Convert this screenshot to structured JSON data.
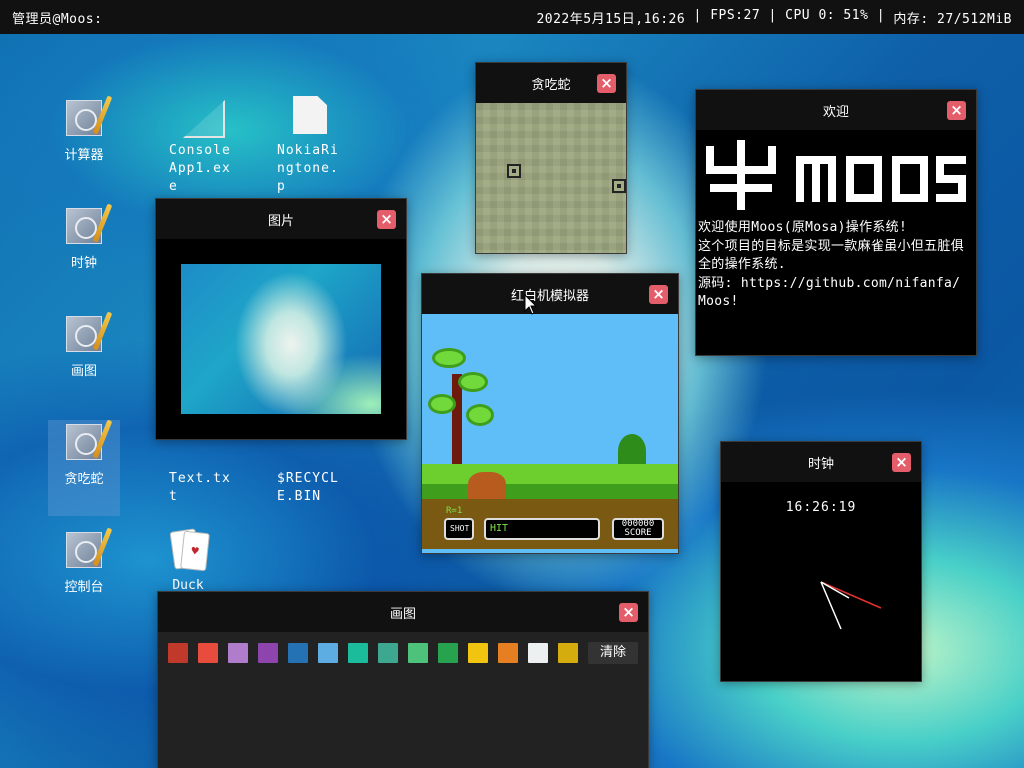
{
  "topbar": {
    "user": "管理员@Moos:",
    "datetime": "2022年5月15日,16:26",
    "sep": " | ",
    "fps": "FPS:27",
    "cpu": "CPU 0: 51%",
    "memory": "内存: 27/512MiB"
  },
  "desktop": {
    "icons": [
      {
        "label": "计算器"
      },
      {
        "label": "时钟"
      },
      {
        "label": "画图"
      },
      {
        "label": "贪吃蛇"
      },
      {
        "label": "控制台"
      }
    ],
    "files": [
      {
        "label": "ConsoleApp1.exe"
      },
      {
        "label": "NokiaRingtone.p"
      },
      {
        "label": "Text.txt"
      },
      {
        "label": "$RECYCLE.BIN"
      },
      {
        "label": "Duck"
      }
    ]
  },
  "windows": {
    "snake": {
      "title": "贪吃蛇",
      "close": "×"
    },
    "picture": {
      "title": "图片",
      "close": "×"
    },
    "nes": {
      "title": "红白机模拟器",
      "close": "×",
      "hud_round": "R=1",
      "hud_shot": "SHOT",
      "hud_hit": "HIT",
      "hud_score_value": "000000",
      "hud_score": "SCORE"
    },
    "welcome": {
      "title": "欢迎",
      "close": "×",
      "lines": [
        "欢迎使用Moos(原Mosa)操作系统!",
        "这个项目的目标是实现一款麻雀虽小但五脏俱",
        "全的操作系统.",
        "源码: https://github.com/nifanfa/",
        "Moos!"
      ]
    },
    "clock": {
      "title": "时钟",
      "close": "×",
      "time": "16:26:19"
    },
    "paint": {
      "title": "画图",
      "close": "×",
      "clear_label": "清除",
      "swatches": [
        "#c0392b",
        "#e74c3c",
        "#b07ccc",
        "#8e44ad",
        "#2472b3",
        "#5dade2",
        "#1abc9c",
        "#3da88f",
        "#4ec17a",
        "#27a24f",
        "#f1c40f",
        "#e67e22",
        "#ecf0f1",
        "#d4ac0d"
      ]
    }
  }
}
